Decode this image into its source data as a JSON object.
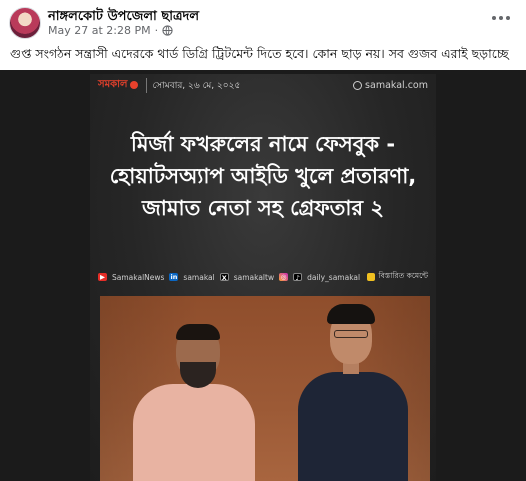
{
  "post": {
    "page_name": "নাঙ্গলকোট উপজেলা ছাত্রদল",
    "timestamp": "May 27 at 2:28 PM",
    "separator": "·",
    "caption": "গুপ্ত সংগঠন সন্ত্রাসী এদেরকে থার্ড ডিগ্রি ট্রিটমেন্ট দিতে হবে। কোন ছাড় নয়। সব গুজব এরাই ছড়াচ্ছে"
  },
  "news_card": {
    "brand": "সমকাল",
    "date": "সোমবার, ২৬ মে, ২০২৫",
    "site_url": "samakal.com",
    "headline_lines": [
      "মির্জা ফখরুলের নামে ফেসবুক -",
      "হোয়াটসঅ্যাপ আইডি খুলে প্রতারণা,",
      "জামাত নেতা সহ গ্রেফতার ২"
    ],
    "socials": {
      "youtube": "SamakalNews",
      "linkedin": "samakal",
      "x": "samakaltw",
      "instagram": "daily_samakal",
      "comment": "বিস্তারিত কমেন্টে"
    }
  },
  "colors": {
    "accent_brand": "#e7412c",
    "text_primary": "#050505",
    "text_secondary": "#65676b"
  },
  "icons": [
    "globe-icon",
    "more-icon",
    "youtube-icon",
    "linkedin-icon",
    "x-icon",
    "instagram-icon",
    "tiktok-icon",
    "hand-pointer-icon"
  ]
}
